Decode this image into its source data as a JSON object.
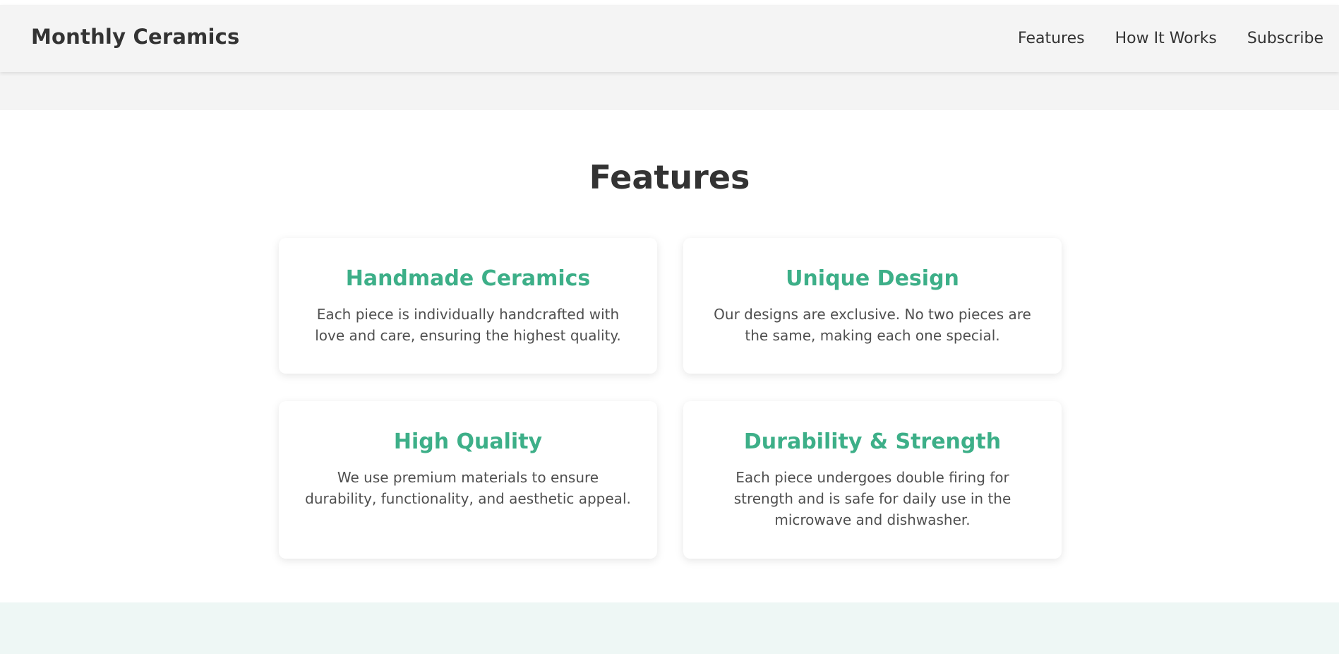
{
  "header": {
    "logo": "Monthly Ceramics",
    "nav": [
      "Features",
      "How It Works",
      "Subscribe"
    ]
  },
  "features": {
    "title": "Features",
    "cards": [
      {
        "title": "Handmade Ceramics",
        "desc": "Each piece is individually handcrafted with love and care, ensuring the highest quality."
      },
      {
        "title": "Unique Design",
        "desc": "Our designs are exclusive. No two pieces are the same, making each one special."
      },
      {
        "title": "High Quality",
        "desc": "We use premium materials to ensure durability, functionality, and aesthetic appeal."
      },
      {
        "title": "Durability & Strength",
        "desc": "Each piece undergoes double firing for strength and is safe for daily use in the microwave and dishwasher."
      }
    ]
  },
  "colors": {
    "accent": "#3daf88",
    "header_bg": "#f4f4f4",
    "text": "#333333",
    "bottom_band": "#eef7f5"
  }
}
